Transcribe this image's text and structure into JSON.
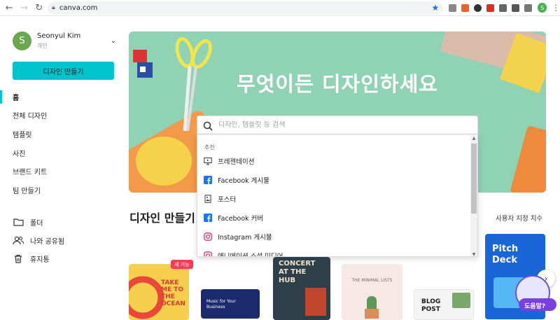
{
  "browser": {
    "url": "canva.com"
  },
  "user": {
    "name": "Seonyul Kim",
    "subtitle": "개인",
    "initial": "S"
  },
  "sidebar": {
    "create_button": "디자인 만들기",
    "nav": [
      {
        "label": "홈",
        "active": true
      },
      {
        "label": "전체 디자인"
      },
      {
        "label": "템플릿"
      },
      {
        "label": "사진"
      },
      {
        "label": "브랜드 키트"
      },
      {
        "label": "팀 만들기"
      }
    ],
    "nav2": [
      {
        "label": "폴더",
        "icon": "folder-icon"
      },
      {
        "label": "나와 공유됨",
        "icon": "people-icon"
      },
      {
        "label": "휴지통",
        "icon": "trash-icon"
      }
    ]
  },
  "hero": {
    "title": "무엇이든 디자인하세요"
  },
  "search": {
    "placeholder": "디자인, 템플릿 등 검색"
  },
  "dropdown": {
    "header": "추천",
    "items": [
      {
        "label": "프레젠테이션",
        "icon": "presentation-icon"
      },
      {
        "label": "Facebook 게시물",
        "icon": "facebook-icon"
      },
      {
        "label": "포스터",
        "icon": "poster-icon"
      },
      {
        "label": "Facebook 커버",
        "icon": "facebook-icon"
      },
      {
        "label": "Instagram 게시물",
        "icon": "instagram-icon"
      },
      {
        "label": "애니메이션 소셜 미디어",
        "icon": "instagram-icon"
      }
    ]
  },
  "section": {
    "title": "디자인 만들기",
    "custom_size": "사용자 지정 치수"
  },
  "thumbnails": {
    "badge": "새 기능",
    "t1": "TAKE ME TO THE OCEAN",
    "t2a": "Music for Your",
    "t2b": "Business",
    "t3a": "CONCERT",
    "t3b": "AT THE",
    "t3c": "HUB",
    "t4": "THE MINIMAL LISTS",
    "t5a": "BLOG",
    "t5b": "POST",
    "t6a": "Pitch",
    "t6b": "Deck"
  },
  "help": {
    "label": "도움말?"
  },
  "colors": {
    "accent": "#00c4cc",
    "hero_bg": "#8fd3b4",
    "badge": "#ff3a57"
  }
}
